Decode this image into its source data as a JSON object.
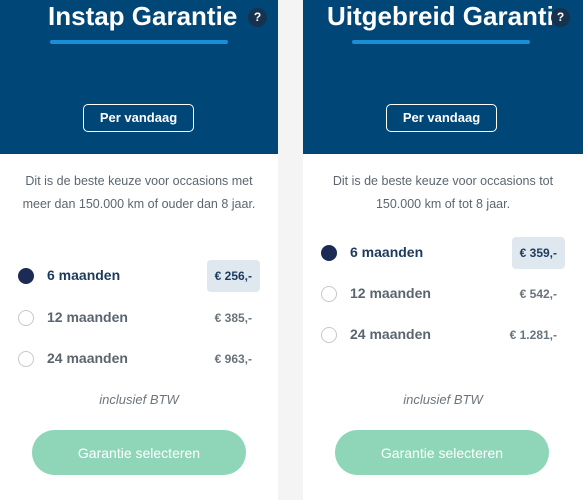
{
  "colors": {
    "header_bg": "#004677",
    "underline": "#1b8fd6",
    "button_bg": "#8fd6b9",
    "radio_checked": "#1c2b55",
    "price_selected_bg": "#dfe8ee"
  },
  "cards": [
    {
      "title": "Instap Garantie",
      "help_icon": "?",
      "badge": "Per vandaag",
      "description": "Dit is de beste keuze voor occasions met meer dan 150.000 km of ouder dan 8 jaar.",
      "options": [
        {
          "label": "6 maanden",
          "price": "€ 256,-",
          "selected": true
        },
        {
          "label": "12 maanden",
          "price": "€ 385,-",
          "selected": false
        },
        {
          "label": "24 maanden",
          "price": "€ 963,-",
          "selected": false
        }
      ],
      "vat_note": "inclusief BTW",
      "button_label": "Garantie selecteren"
    },
    {
      "title": "Uitgebreid Garantie",
      "help_icon": "?",
      "badge": "Per vandaag",
      "description": "Dit is de beste keuze voor occasions tot 150.000 km of tot 8 jaar.",
      "options": [
        {
          "label": "6 maanden",
          "price": "€ 359,-",
          "selected": true
        },
        {
          "label": "12 maanden",
          "price": "€ 542,-",
          "selected": false
        },
        {
          "label": "24 maanden",
          "price": "€ 1.281,-",
          "selected": false
        }
      ],
      "vat_note": "inclusief BTW",
      "button_label": "Garantie selecteren"
    }
  ]
}
